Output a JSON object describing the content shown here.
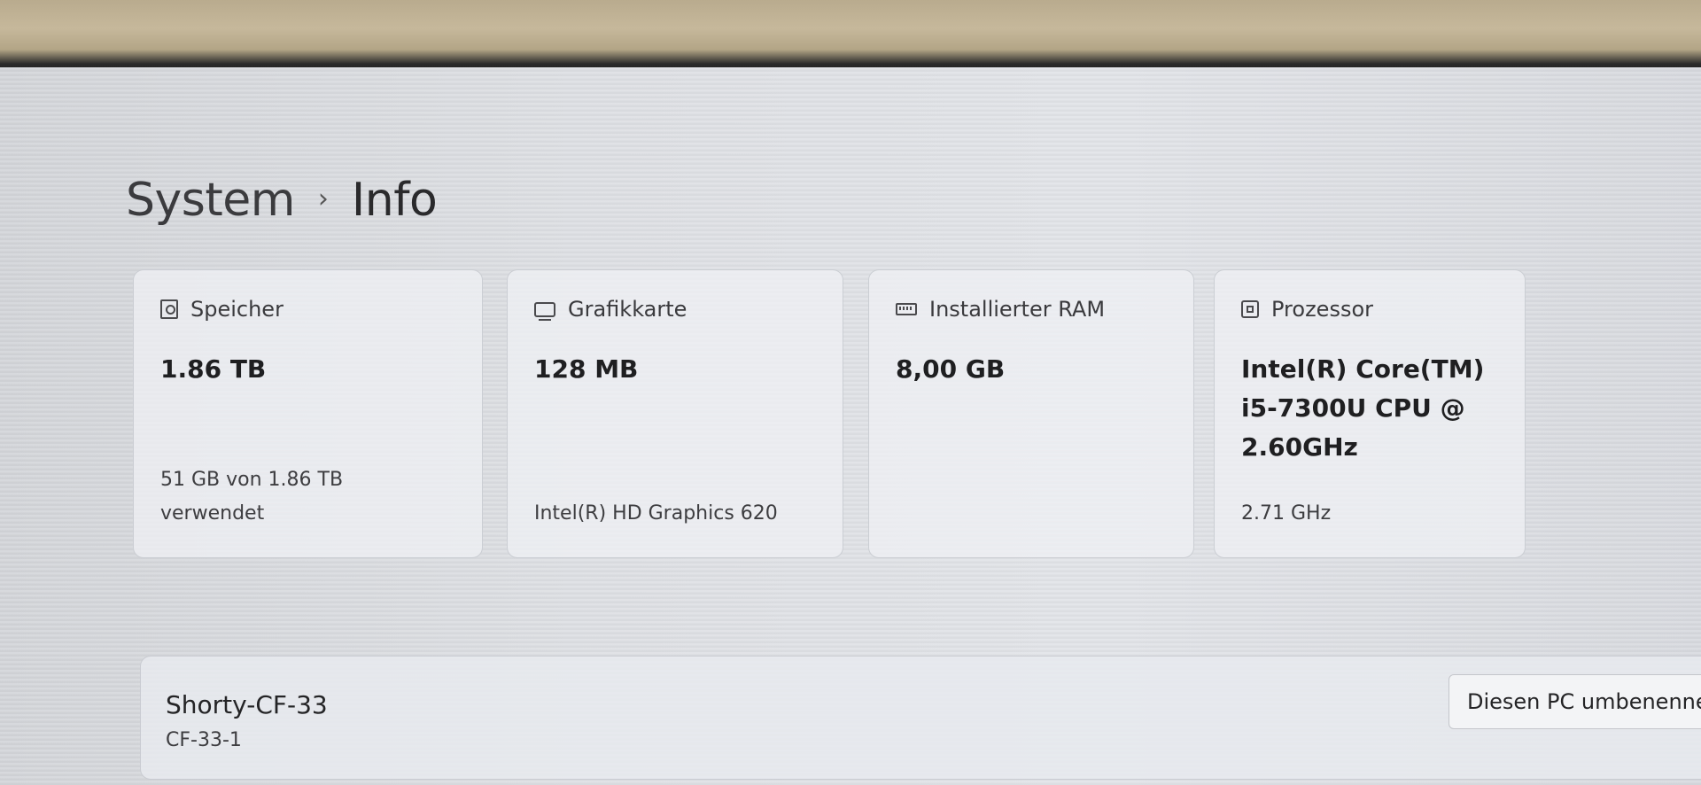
{
  "breadcrumb": {
    "parent": "System",
    "separator": "›",
    "current": "Info"
  },
  "specs": {
    "storage": {
      "icon": "storage-icon",
      "label": "Speicher",
      "value": "1.86 TB",
      "detail_line1": "51 GB von 1.86 TB",
      "detail_line2": "verwendet"
    },
    "graphics": {
      "icon": "graphics-card-icon",
      "label": "Grafikkarte",
      "value": "128 MB",
      "detail": "Intel(R) HD Graphics 620"
    },
    "ram": {
      "icon": "ram-icon",
      "label": "Installierter RAM",
      "value": "8,00 GB"
    },
    "processor": {
      "icon": "processor-icon",
      "label": "Prozessor",
      "value_line1": "Intel(R) Core(TM)",
      "value_line2": "i5-7300U CPU @",
      "value_line3": "2.60GHz",
      "detail": "2.71 GHz"
    }
  },
  "device": {
    "name": "Shorty-CF-33",
    "model": "CF-33-1",
    "rename_label": "Diesen PC umbenennen"
  },
  "colors": {
    "screen_background": "#dfe1e5",
    "card_background": "#eef0f4",
    "text_primary": "#1f1f21"
  }
}
